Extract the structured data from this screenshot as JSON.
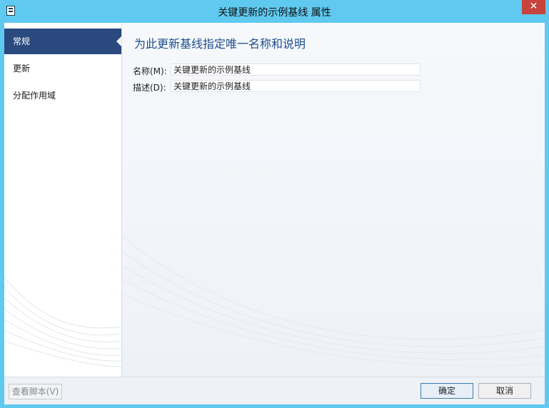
{
  "window": {
    "title": "关键更新的示例基线 属性",
    "close_glyph": "✕"
  },
  "nav": {
    "items": [
      {
        "label": "常规",
        "active": true
      },
      {
        "label": "更新",
        "active": false
      },
      {
        "label": "分配作用域",
        "active": false
      }
    ]
  },
  "main": {
    "heading": "为此更新基线指定唯一名称和说明",
    "name_label": "名称(M):",
    "name_value": "关键更新的示例基线",
    "desc_label": "描述(D):",
    "desc_value": "关键更新的示例基线"
  },
  "footer": {
    "view_script_label": "查看脚本(V)",
    "ok_label": "确定",
    "cancel_label": "取消"
  },
  "colors": {
    "frame": "#5fc9ef",
    "nav_active": "#2a4a7f",
    "heading": "#1f4e8c",
    "close": "#c7433d"
  }
}
